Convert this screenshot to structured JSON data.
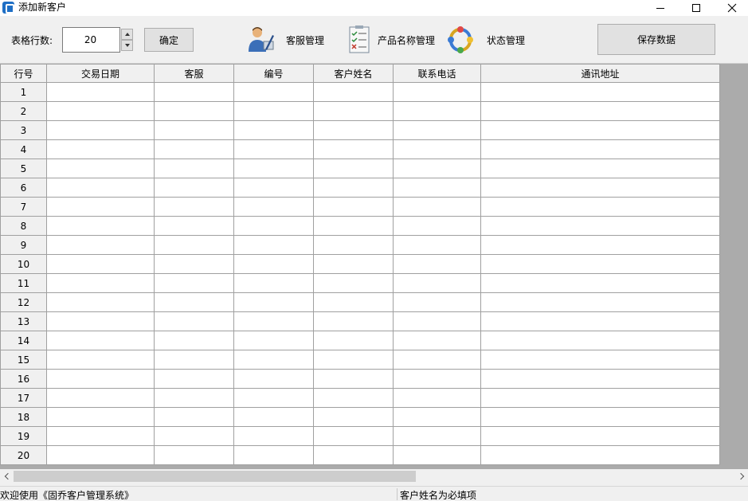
{
  "window": {
    "title": "添加新客户",
    "min_icon": "minimize-icon",
    "max_icon": "maximize-icon",
    "close_icon": "close-icon"
  },
  "toolbar": {
    "rows_label": "表格行数:",
    "rows_value": "20",
    "confirm_label": "确定",
    "service_label": "客服管理",
    "product_label": "产品名称管理",
    "status_label": "状态管理",
    "save_label": "保存数据",
    "service_icon": "user-edit-icon",
    "product_icon": "checklist-icon",
    "status_icon": "refresh-cycle-icon"
  },
  "table": {
    "columns": [
      "行号",
      "交易日期",
      "客服",
      "编号",
      "客户姓名",
      "联系电话",
      "通讯地址"
    ],
    "rows": [
      "1",
      "2",
      "3",
      "4",
      "5",
      "6",
      "7",
      "8",
      "9",
      "10",
      "11",
      "12",
      "13",
      "14",
      "15",
      "16",
      "17",
      "18",
      "19",
      "20"
    ]
  },
  "status": {
    "left": "欢迎使用《固乔客户管理系统》",
    "right": "客户姓名为必填项"
  }
}
